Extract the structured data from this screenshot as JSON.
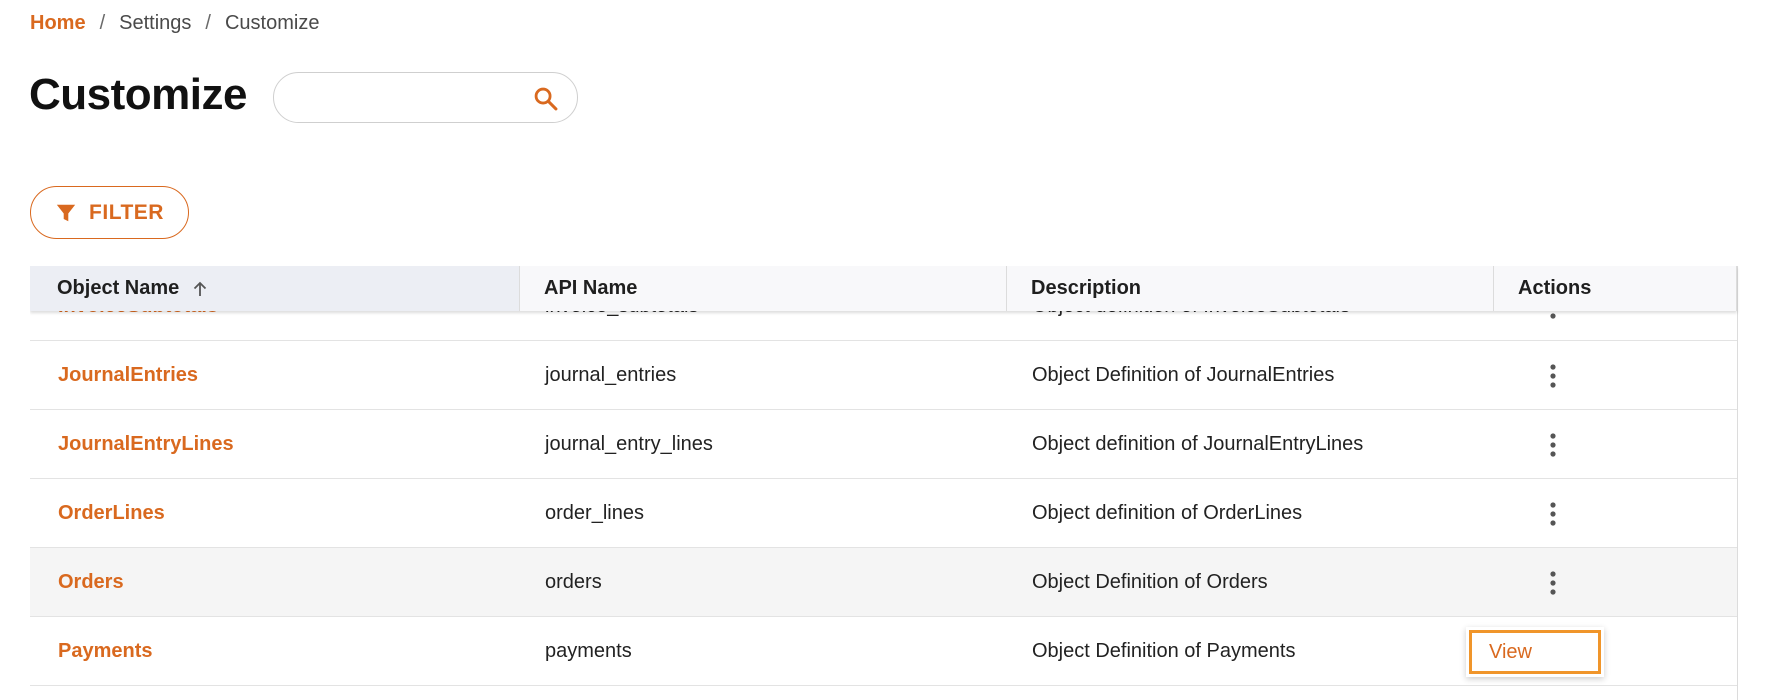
{
  "breadcrumb": {
    "home": "Home",
    "separator": "/",
    "settings": "Settings",
    "current": "Customize"
  },
  "page": {
    "title": "Customize"
  },
  "search": {
    "value": "",
    "placeholder": "",
    "icon": "search-icon"
  },
  "filter": {
    "label": "FILTER",
    "icon": "filter-icon"
  },
  "table": {
    "columns": {
      "name": "Object Name",
      "api": "API Name",
      "description": "Description",
      "actions": "Actions"
    },
    "sort": {
      "column": "Object Name",
      "direction": "ascending"
    },
    "rows": [
      {
        "name": "InvoiceSubtotals",
        "api": "invoice_subtotals",
        "description": "Object definition of InvoiceSubtotals"
      },
      {
        "name": "JournalEntries",
        "api": "journal_entries",
        "description": "Object Definition of JournalEntries"
      },
      {
        "name": "JournalEntryLines",
        "api": "journal_entry_lines",
        "description": "Object definition of JournalEntryLines"
      },
      {
        "name": "OrderLines",
        "api": "order_lines",
        "description": "Object definition of OrderLines"
      },
      {
        "name": "Orders",
        "api": "orders",
        "description": "Object Definition of Orders"
      },
      {
        "name": "Payments",
        "api": "payments",
        "description": "Object Definition of Payments"
      }
    ]
  },
  "action_menu": {
    "view_label": "View"
  },
  "colors": {
    "accent": "#d9691f",
    "focus_outline": "#f0952a",
    "header_bg": "#f8f8fa",
    "row_hover": "#f5f5f5"
  }
}
